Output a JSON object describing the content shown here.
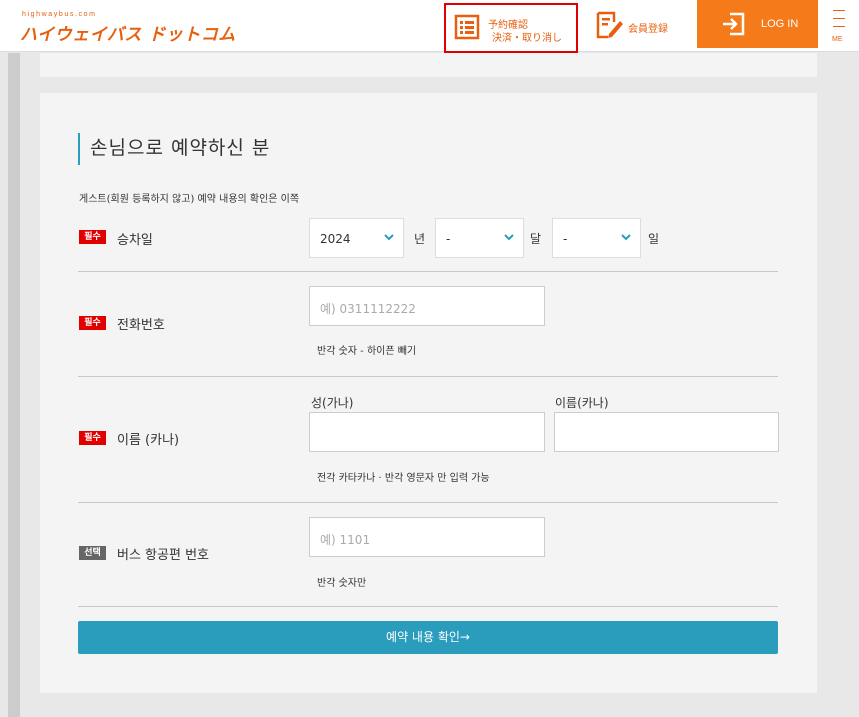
{
  "header": {
    "logo_small": "highwaybus.com",
    "logo_main": "ハイウェイバス ドットコム",
    "reserve_line1": "予約確認",
    "reserve_line2": "決済・取り消し",
    "register_label": "会員登録",
    "login_label": "LOG IN",
    "menu_label": "ME"
  },
  "form": {
    "title": "손님으로 예약하신 분",
    "subtitle": "게스트(회원 등록하지 않고) 예약 내용의 확인은 이쪽",
    "required_badge": "필수",
    "optional_badge": "선택",
    "boarding_date": {
      "label": "승차일",
      "year_value": "2024",
      "year_unit": "년",
      "month_value": "-",
      "month_unit": "달",
      "day_value": "-",
      "day_unit": "일"
    },
    "phone": {
      "label": "전화번호",
      "placeholder": "예) 0311112222",
      "note": "반각 숫자 - 하이픈 빼기"
    },
    "name": {
      "label": "이름 (카나)",
      "last_head": "성(가나)",
      "first_head": "이름(카나)",
      "note": "전각 카타카나 · 반각 영문자 만 입력 가능"
    },
    "flight": {
      "label": "버스 항공편 번호",
      "placeholder": "예) 1101",
      "note": "반각 숫자만"
    },
    "submit_label": "예약 내용 확인→"
  },
  "colors": {
    "accent_orange": "#f57a1a",
    "accent_blue": "#2a9dbd",
    "required_red": "#e00000"
  }
}
